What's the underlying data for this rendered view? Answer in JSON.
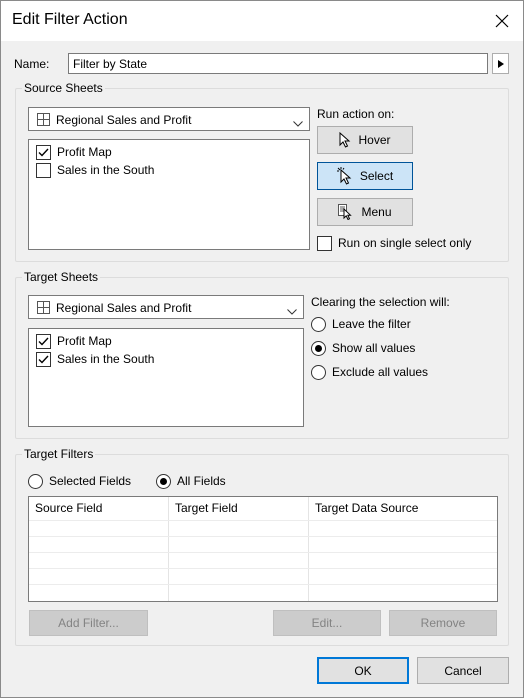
{
  "window": {
    "title": "Edit Filter Action",
    "close_icon": "close-icon"
  },
  "name": {
    "label": "Name:",
    "value": "Filter by State"
  },
  "source_sheets": {
    "title": "Source Sheets",
    "combo_value": "Regional Sales and Profit",
    "items": [
      {
        "label": "Profit Map",
        "checked": true
      },
      {
        "label": "Sales in the South",
        "checked": false
      }
    ]
  },
  "run_action": {
    "label": "Run action on:",
    "buttons": [
      {
        "label": "Hover",
        "icon": "hover-pointer-icon",
        "selected": false
      },
      {
        "label": "Select",
        "icon": "select-pointer-icon",
        "selected": true
      },
      {
        "label": "Menu",
        "icon": "menu-pointer-icon",
        "selected": false
      }
    ],
    "single_select": {
      "label": "Run on single select only",
      "checked": false
    }
  },
  "target_sheets": {
    "title": "Target Sheets",
    "combo_value": "Regional Sales and Profit",
    "items": [
      {
        "label": "Profit Map",
        "checked": true
      },
      {
        "label": "Sales in the South",
        "checked": true
      }
    ]
  },
  "clearing": {
    "label": "Clearing the selection will:",
    "options": [
      {
        "label": "Leave the filter",
        "selected": false
      },
      {
        "label": "Show all values",
        "selected": true
      },
      {
        "label": "Exclude all values",
        "selected": false
      }
    ]
  },
  "target_filters": {
    "title": "Target Filters",
    "options": [
      {
        "label": "Selected Fields",
        "selected": false
      },
      {
        "label": "All Fields",
        "selected": true
      }
    ],
    "columns": [
      "Source Field",
      "Target Field",
      "Target Data Source"
    ],
    "buttons": {
      "add": "Add Filter...",
      "edit": "Edit...",
      "remove": "Remove"
    }
  },
  "footer": {
    "ok": "OK",
    "cancel": "Cancel"
  },
  "colors": {
    "accent": "#0078d7",
    "selected_bg": "#cce4f7",
    "dialog_bg": "#f0f0f0"
  }
}
